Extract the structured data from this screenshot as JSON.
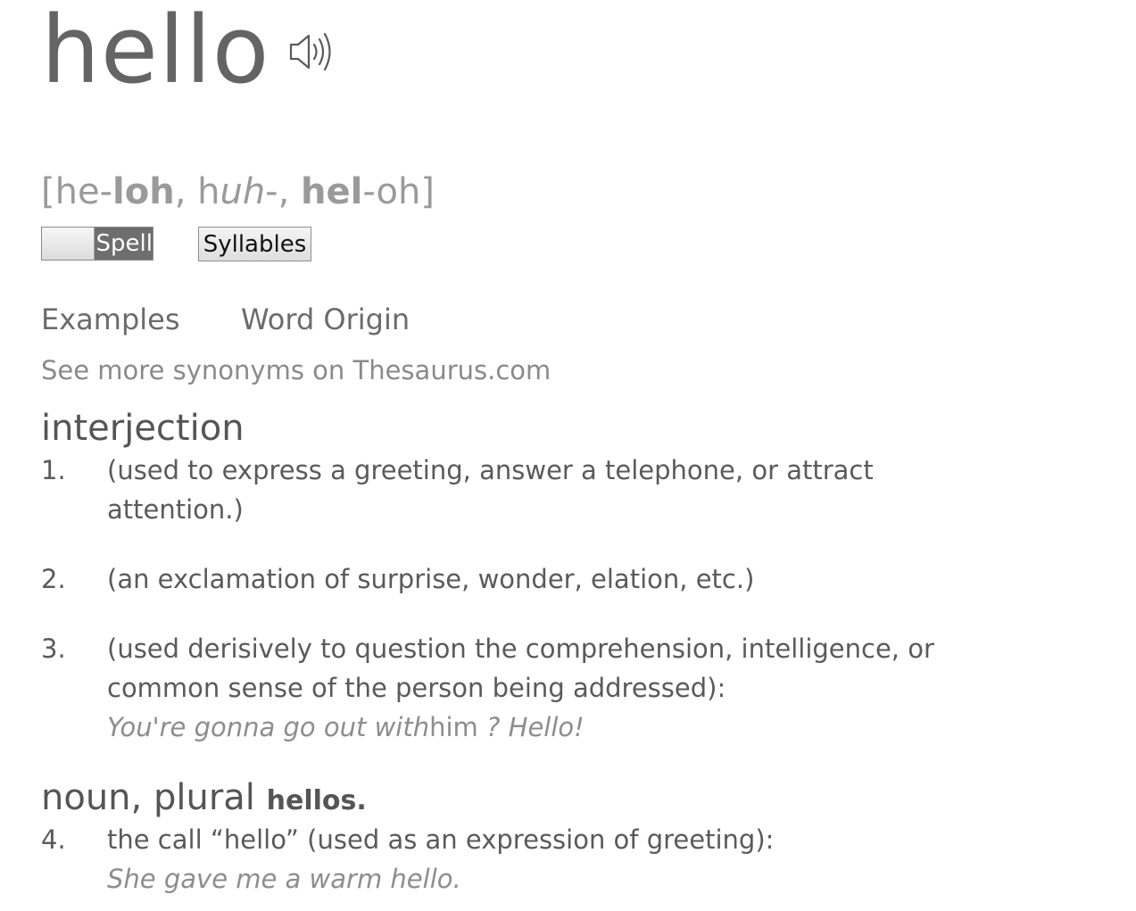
{
  "headword": "hello",
  "audio": {
    "icon": "speaker-icon"
  },
  "pronunciation": {
    "open_bracket": "[",
    "p1a": "he-",
    "p1b": "loh",
    "sep1": ", h",
    "p2a": "uh",
    "p2b": "-, ",
    "p3a": "hel",
    "p3b": "-oh",
    "close_bracket": "]"
  },
  "controls": {
    "spell_label": "Spell",
    "syllables_label": "Syllables"
  },
  "tabs": {
    "examples": "Examples",
    "word_origin": "Word Origin"
  },
  "thesaurus_link": "See more synonyms on Thesaurus.com",
  "sections": {
    "interjection": {
      "pos": "interjection",
      "definitions": [
        {
          "num": "1.",
          "text": "(used to express a greeting, answer a telephone, or attract attention.)"
        },
        {
          "num": "2.",
          "text": "(an exclamation of surprise, wonder, elation, etc.)"
        },
        {
          "num": "3.",
          "text": "(used derisively to question the comprehension, intelligence, or common sense of the person being addressed):",
          "example_a": "You're gonna go out with",
          "example_b": "him",
          "example_c": " ? Hello!"
        }
      ]
    },
    "noun": {
      "pos": "noun, plural",
      "plural": "hellos.",
      "definitions": [
        {
          "num": "4.",
          "text": "the call “hello” (used as an expression of greeting):",
          "example": "She gave me a warm hello."
        }
      ]
    }
  }
}
